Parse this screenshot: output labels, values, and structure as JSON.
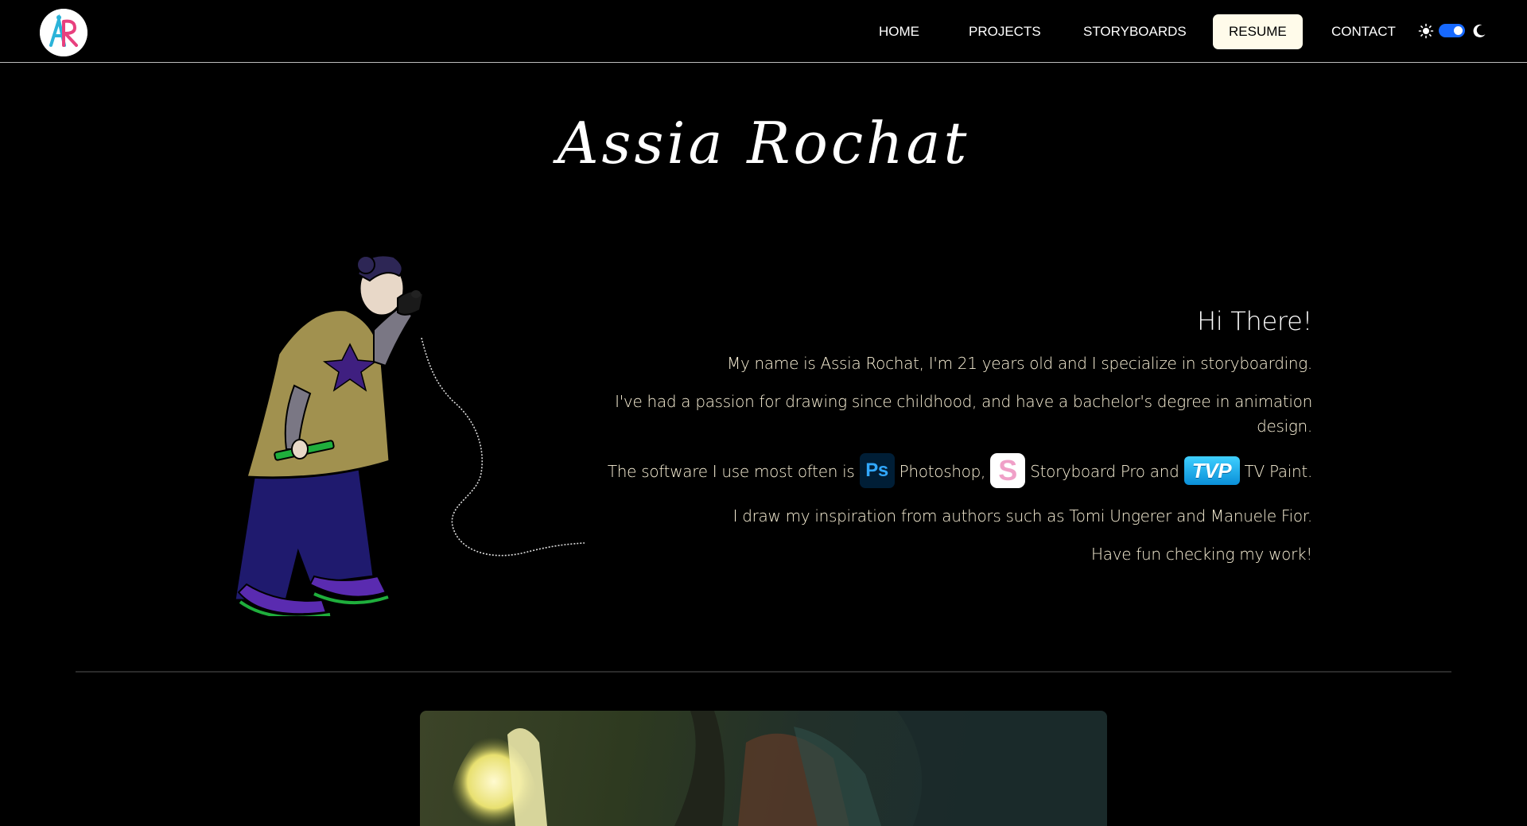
{
  "header": {
    "logo_text": "AR",
    "nav": [
      {
        "label": "HOME"
      },
      {
        "label": "PROJECTS"
      },
      {
        "label": "STORYBOARDS"
      },
      {
        "label": "RESUME",
        "active": true
      },
      {
        "label": "CONTACT"
      }
    ],
    "theme_toggle": {
      "mode": "dark",
      "on": true
    }
  },
  "hero": {
    "title": "Assia Rochat",
    "greeting": "Hi There!",
    "intro_line": "My name is Assia Rochat, I'm 21 years old and I specialize in storyboarding.",
    "passion_line": "I've had a passion for drawing since childhood, and have a bachelor's degree in animation design.",
    "software": {
      "prefix": "The software I use most often is",
      "apps": [
        {
          "name": "Photoshop,",
          "icon": "photoshop-icon",
          "glyph": "Ps"
        },
        {
          "name": "Storyboard Pro and",
          "icon": "storyboard-pro-icon",
          "glyph": "S"
        },
        {
          "name": "TV Paint.",
          "icon": "tvpaint-icon",
          "glyph": "TVP"
        }
      ]
    },
    "inspiration_line": "I draw my inspiration from authors such as Tomi Ungerer and Manuele Fior.",
    "closing_line": "Have fun checking my work!"
  },
  "colors": {
    "accent": "#1769ff",
    "active_nav_bg": "#fffbea",
    "body_text": "#fbf2d8",
    "coat": "#a1914f",
    "trousers": "#1f1a6e",
    "shoes": "#5a2bb0"
  }
}
